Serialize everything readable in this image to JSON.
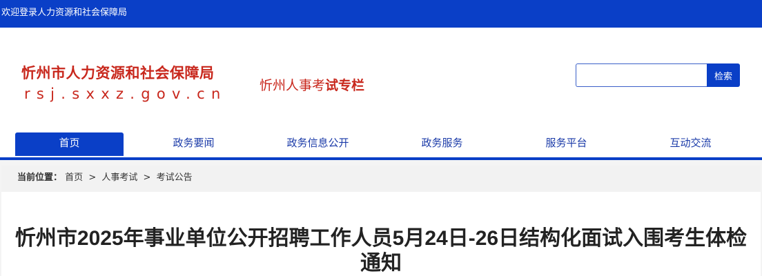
{
  "topbar": {
    "welcome": "欢迎登录人力资源和社会保障局"
  },
  "header": {
    "logo_name": "忻州市人力资源和社会保障局",
    "logo_url": "rsj.sxxz.gov.cn",
    "column_title_prefix": "忻州人事考",
    "column_title_bold": "试专栏"
  },
  "search": {
    "value": "",
    "placeholder": "",
    "button_label": "检索"
  },
  "nav": {
    "items": [
      {
        "label": "首页"
      },
      {
        "label": "政务要闻"
      },
      {
        "label": "政务信息公开"
      },
      {
        "label": "政务服务"
      },
      {
        "label": "服务平台"
      },
      {
        "label": "互动交流"
      }
    ]
  },
  "breadcrumb": {
    "label": "当前位置：",
    "items": [
      "首页",
      "人事考试",
      "考试公告"
    ],
    "separator": ">"
  },
  "article": {
    "title": "忻州市2025年事业单位公开招聘工作人员5月24日-26日结构化面试入围考生体检通知"
  },
  "colors": {
    "primary_blue": "#0a3fc7",
    "logo_red": "#c8271c"
  }
}
